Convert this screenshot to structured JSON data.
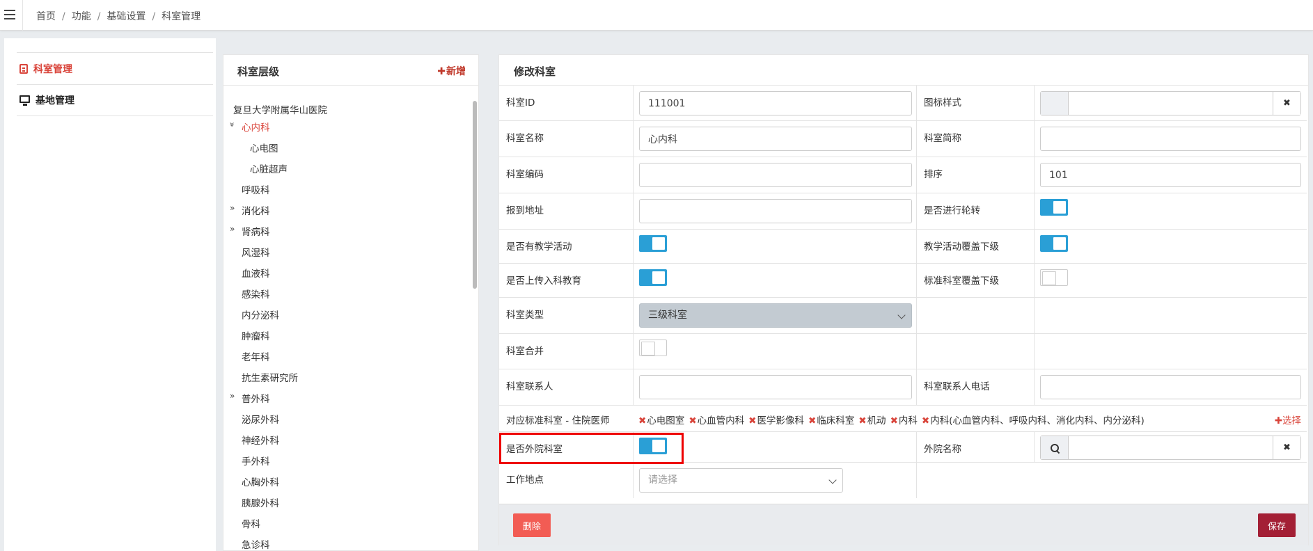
{
  "breadcrumb": [
    "首页",
    "功能",
    "基础设置",
    "科室管理"
  ],
  "sidebar": {
    "items": [
      {
        "label": "科室管理",
        "active": true
      },
      {
        "label": "基地管理",
        "active": false
      }
    ]
  },
  "tree": {
    "title": "科室层级",
    "add_label": "新增",
    "root": "复旦大学附属华山医院",
    "nodes": [
      {
        "label": "心内科",
        "arrow": "expanded",
        "active": true
      },
      {
        "label": "心电图",
        "child": true
      },
      {
        "label": "心脏超声",
        "child": true
      },
      {
        "label": "呼吸科"
      },
      {
        "label": "消化科",
        "arrow": "collapsed"
      },
      {
        "label": "肾病科",
        "arrow": "collapsed"
      },
      {
        "label": "风湿科"
      },
      {
        "label": "血液科"
      },
      {
        "label": "感染科"
      },
      {
        "label": "内分泌科"
      },
      {
        "label": "肿瘤科"
      },
      {
        "label": "老年科"
      },
      {
        "label": "抗生素研究所"
      },
      {
        "label": "普外科",
        "arrow": "collapsed"
      },
      {
        "label": "泌尿外科"
      },
      {
        "label": "神经外科"
      },
      {
        "label": "手外科"
      },
      {
        "label": "心胸外科"
      },
      {
        "label": "胰腺外科"
      },
      {
        "label": "骨科"
      },
      {
        "label": "急诊科"
      }
    ]
  },
  "form": {
    "title": "修改科室",
    "fields": {
      "dept_id": {
        "label": "科室ID",
        "value": "111001"
      },
      "icon_style": {
        "label": "图标样式",
        "value": ""
      },
      "dept_name": {
        "label": "科室名称",
        "value": "心内科"
      },
      "dept_short": {
        "label": "科室简称",
        "value": ""
      },
      "dept_code": {
        "label": "科室编码",
        "value": ""
      },
      "sort": {
        "label": "排序",
        "value": "101"
      },
      "report_addr": {
        "label": "报到地址",
        "value": ""
      },
      "rotation": {
        "label": "是否进行轮转",
        "on": true
      },
      "teaching": {
        "label": "是否有教学活动",
        "on": true
      },
      "teaching_cover": {
        "label": "教学活动覆盖下级",
        "on": true
      },
      "upload_edu": {
        "label": "是否上传入科教育",
        "on": true
      },
      "std_cover": {
        "label": "标准科室覆盖下级",
        "on": false
      },
      "dept_type": {
        "label": "科室类型",
        "value": "三级科室"
      },
      "merge": {
        "label": "科室合并",
        "on": false
      },
      "contact": {
        "label": "科室联系人",
        "value": ""
      },
      "contact_phone": {
        "label": "科室联系人电话",
        "value": ""
      },
      "std_dept": {
        "label": "对应标准科室 - 住院医师",
        "choose_label": "选择"
      },
      "external": {
        "label": "是否外院科室",
        "on": true
      },
      "external_name": {
        "label": "外院名称",
        "value": ""
      },
      "work_place": {
        "label": "工作地点",
        "placeholder": "请选择"
      }
    },
    "std_tags": [
      "心电图室",
      "心血管内科",
      "医学影像科",
      "临床科室",
      "机动",
      "内科",
      "内科(心血管内科、呼吸内科、消化内科、内分泌科)"
    ],
    "delete_label": "删除",
    "save_label": "保存"
  },
  "colors": {
    "accent": "#d9443a",
    "toggle_on": "#2a9fd6",
    "save": "#a31f35",
    "delete": "#f25c54"
  }
}
